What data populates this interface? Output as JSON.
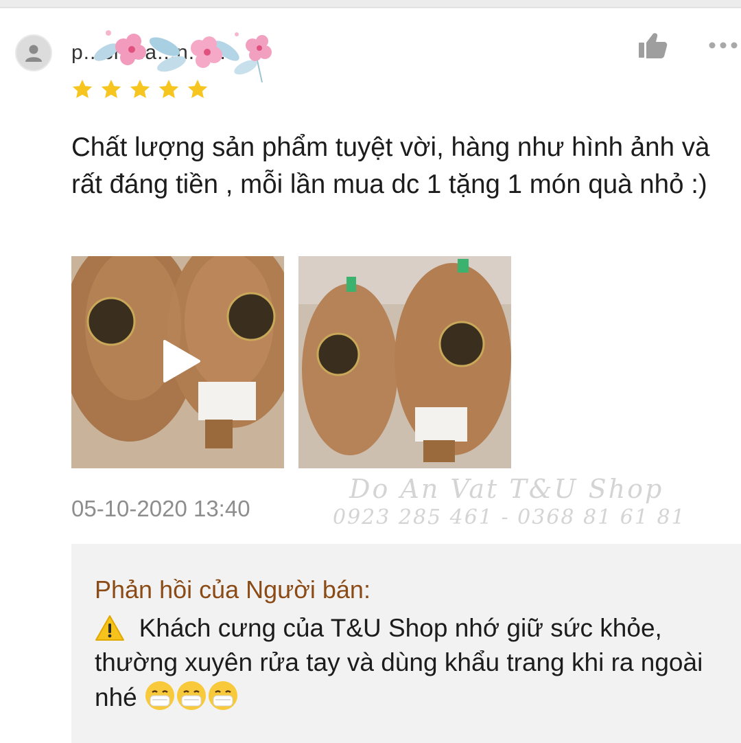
{
  "review": {
    "username": "p...ch...a...n...9...",
    "rating": 5,
    "comment": "Chất lượng sản phẩm tuyệt vời, hàng như hình ảnh và rất đáng tiền , mỗi lần mua dc 1 tặng 1 món quà nhỏ :)",
    "timestamp": "05-10-2020 13:40",
    "media": [
      {
        "type": "video",
        "icon": "play-icon"
      },
      {
        "type": "image"
      }
    ]
  },
  "watermark": {
    "line1": "Do An Vat T&U  Shop",
    "line2": "0923 285 461 - 0368 81 61 81"
  },
  "seller_reply": {
    "title": "Phản hồi của Người bán:",
    "text": "Khách cưng của T&U Shop nhớ giữ sức khỏe, thường xuyên rửa tay và dùng khẩu trang khi ra ngoài nhé"
  },
  "colors": {
    "star": "#f7c520",
    "reply_title": "#8a4b17",
    "timestamp": "#8d8d8d",
    "reply_bg": "#f2f2f2"
  },
  "icons": [
    "user-avatar-icon",
    "thumbs-up-icon",
    "more-options-icon",
    "star-icon",
    "play-icon",
    "warning-icon",
    "mask-face-icon"
  ]
}
